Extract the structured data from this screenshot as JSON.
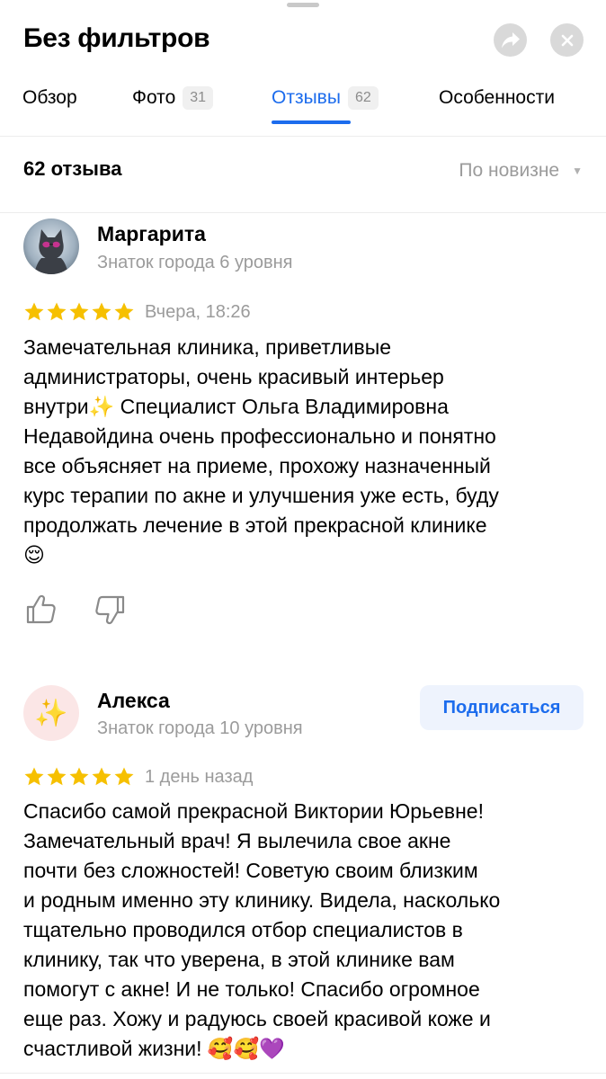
{
  "header": {
    "title": "Без фильтров",
    "share_icon": "share-icon",
    "close_icon": "close-icon"
  },
  "tabs": [
    {
      "label": "Обзор"
    },
    {
      "label": "Фото",
      "count": "31"
    },
    {
      "label": "Отзывы",
      "count": "62",
      "active": true
    },
    {
      "label": "Особенности"
    }
  ],
  "summary": {
    "count_label": "62 отзыва",
    "sort_label": "По новизне"
  },
  "colors": {
    "accent": "#1c6ced",
    "star": "#f6c000",
    "muted": "#9b9b9b"
  },
  "reviews": [
    {
      "author": "Маргарита",
      "level": "Знаток города 6 уровня",
      "rating": 5,
      "date": "Вчера, 18:26",
      "text": "Замечательная клиника, приветливые\nадминистраторы, очень красивый интерьер\nвнутри✨ Специалист Ольга Владимировна\nНедавойдина очень профессионально и понятно\nвсе объясняет на приеме, прохожу назначенный\nкурс терапии по акне и улучшения уже есть, буду\nпродолжать лечение в этой прекрасной клинике\n😌"
    },
    {
      "author": "Алекса",
      "level": "Знаток города 10 уровня",
      "rating": 5,
      "date": "1 день назад",
      "avatar_glyph": "✨",
      "subscribe_label": "Подписаться",
      "text": "Спасибо самой прекрасной Виктории Юрьевне!\nЗамечательный врач!  Я вылечила свое  акне\nпочти без сложностей!   Советую своим  близким\nи родным именно эту клинику. Видела, насколько\nтщательно проводился отбор специалистов в\nклинику, так что уверена, в этой клинике вам\nпомогут с акне!  И не только! Спасибо огромное\nеще раз. Хожу и радуюсь своей красивой коже и\nсчастливой жизни! 🥰🥰💜"
    }
  ]
}
